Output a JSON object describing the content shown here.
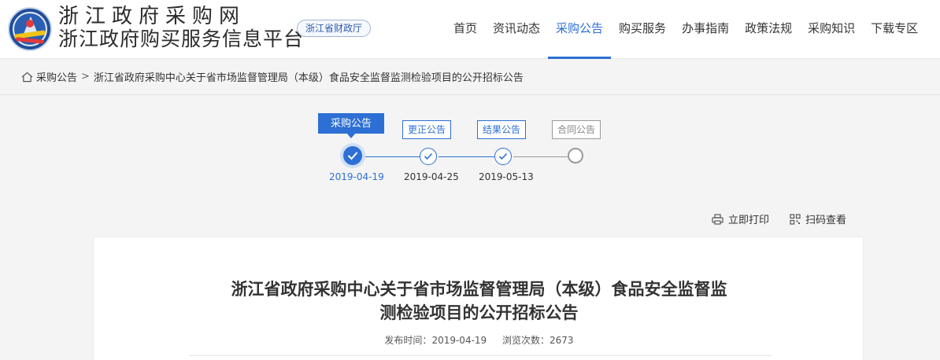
{
  "header": {
    "site_name": "浙江政府采购网",
    "site_subtitle": "浙江政府购买服务信息平台",
    "dept_badge": "浙江省财政厅",
    "nav": [
      "首页",
      "资讯动态",
      "采购公告",
      "购买服务",
      "办事指南",
      "政策法规",
      "采购知识",
      "下载专区"
    ],
    "active_nav": "采购公告"
  },
  "breadcrumb": {
    "root": "采购公告",
    "separator": ">",
    "current": "浙江省政府采购中心关于省市场监督管理局（本级）食品安全监督监测检验项目的公开招标公告"
  },
  "timeline": {
    "steps": [
      {
        "label": "采购公告",
        "date": "2019-04-19",
        "state": "active"
      },
      {
        "label": "更正公告",
        "date": "2019-04-25",
        "state": "done"
      },
      {
        "label": "结果公告",
        "date": "2019-05-13",
        "state": "done"
      },
      {
        "label": "合同公告",
        "date": "",
        "state": "pending"
      }
    ]
  },
  "tools": {
    "print": "立即打印",
    "scan": "扫码查看"
  },
  "article": {
    "title_line1": "浙江省政府采购中心关于省市场监督管理局（本级）食品安全监督监",
    "title_line2": "测检验项目的公开招标公告",
    "publish_label": "发布时间：",
    "publish_date": "2019-04-19",
    "views_label": "浏览次数：",
    "views": "2673"
  },
  "colors": {
    "accent": "#2d6fd4",
    "inactive_grey": "#9a9a9a"
  }
}
